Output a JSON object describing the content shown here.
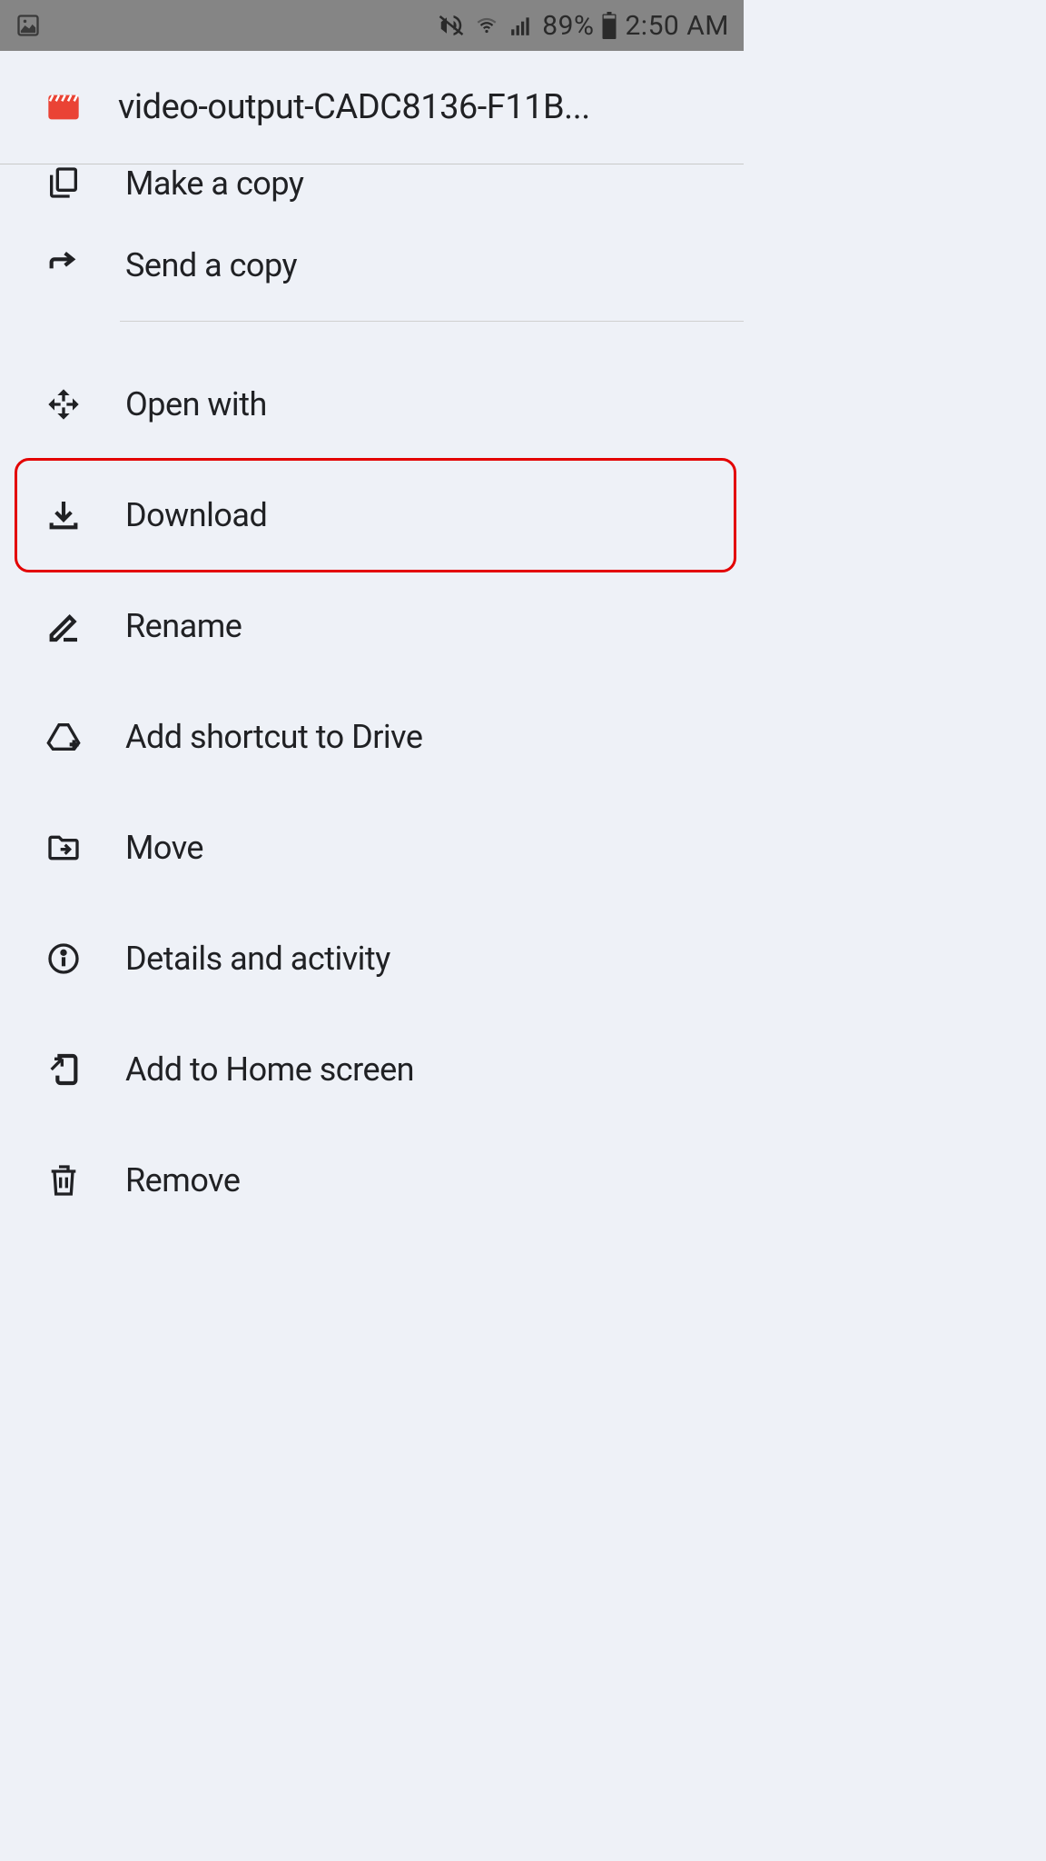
{
  "statusBar": {
    "batteryPercent": "89%",
    "time": "2:50 AM"
  },
  "file": {
    "title": "video-output-CADC8136-F11B..."
  },
  "menu": {
    "makeACopy": "Make a copy",
    "sendACopy": "Send a copy",
    "openWith": "Open with",
    "download": "Download",
    "rename": "Rename",
    "addShortcut": "Add shortcut to Drive",
    "move": "Move",
    "detailsActivity": "Details and activity",
    "addToHome": "Add to Home screen",
    "remove": "Remove"
  }
}
